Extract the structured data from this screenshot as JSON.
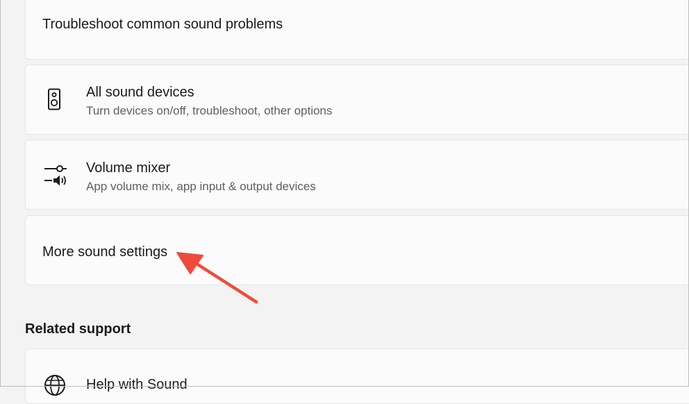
{
  "cards": {
    "troubleshoot": {
      "title": "Troubleshoot common sound problems"
    },
    "all_devices": {
      "title": "All sound devices",
      "subtitle": "Turn devices on/off, troubleshoot, other options",
      "icon": "speaker-icon"
    },
    "volume_mixer": {
      "title": "Volume mixer",
      "subtitle": "App volume mix, app input & output devices",
      "icon": "volume-mixer-icon"
    },
    "more_settings": {
      "title": "More sound settings"
    },
    "help": {
      "title": "Help with Sound",
      "icon": "globe-icon"
    }
  },
  "related_support": {
    "heading": "Related support"
  },
  "annotation": {
    "icon": "red-arrow-icon",
    "color": "#f04a3c"
  }
}
